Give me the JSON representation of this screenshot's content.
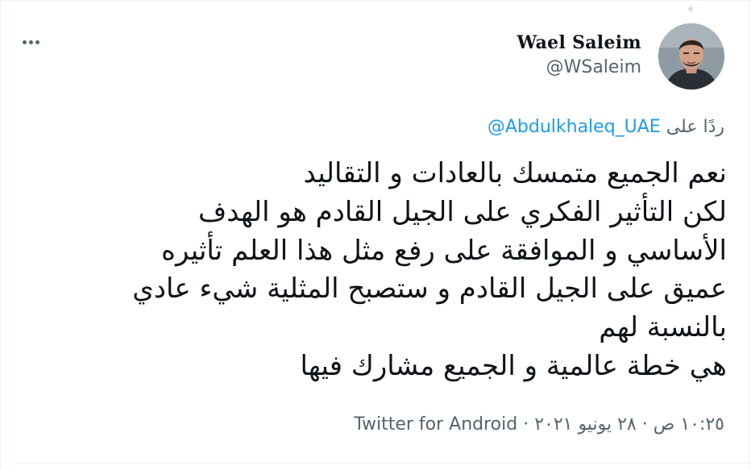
{
  "tweet": {
    "author": {
      "display_name": "Wael Saleim",
      "handle": "@WSaleim"
    },
    "reply": {
      "prefix": "ردًا على",
      "mention": "@Abdulkhaleq_UAE"
    },
    "text_lines": [
      "نعم الجميع متمسك بالعادات و التقاليد",
      "لكن التأثير الفكري على الجيل القادم هو الهدف",
      "الأساسي و الموافقة على رفع مثل هذا العلم تأثيره",
      "عميق على الجيل القادم و ستصبح المثلية شيء عادي",
      "بالنسبة لهم",
      "هي خطة عالمية و الجميع مشارك فيها"
    ],
    "meta": {
      "time": "١٠:٢٥ ص",
      "separator": "·",
      "date": "٢٨ يونيو ٢٠٢١",
      "source": "Twitter for Android"
    }
  },
  "icons": {
    "more": "more-horizontal-icon",
    "avatar": "profile-photo"
  },
  "colors": {
    "text_primary": "#0f1419",
    "text_secondary": "#536471",
    "link": "#1d9bf0",
    "border": "#eff3f4"
  }
}
